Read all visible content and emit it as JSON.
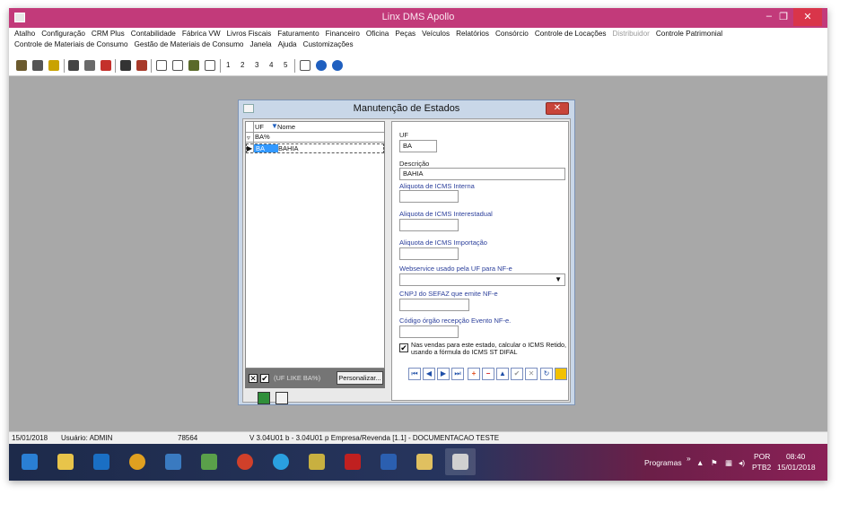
{
  "window": {
    "title": "Linx DMS Apollo",
    "minimize_glyph": "–",
    "restore_glyph": "❐",
    "close_glyph": "✕"
  },
  "menu": {
    "row1": [
      "Atalho",
      "Configuração",
      "CRM Plus",
      "Contabilidade",
      "Fábrica VW",
      "Livros Fiscais",
      "Faturamento",
      "Financeiro",
      "Oficina",
      "Peças",
      "Veículos",
      "Relatórios",
      "Consórcio",
      "Controle de Locações",
      "Distribuidor",
      "Controle Patrimonial"
    ],
    "row1_disabled": "Distribuidor",
    "row2": [
      "Controle de Materiais de Consumo",
      "Gestão de Materiais de Consumo",
      "Janela",
      "Ajuda",
      "Customizações"
    ]
  },
  "toolbar": {
    "numbers": [
      "1",
      "2",
      "3",
      "4",
      "5"
    ]
  },
  "dialog": {
    "title": "Manutenção de Estados",
    "close_glyph": "✕",
    "grid": {
      "col_uf": "UF",
      "col_nome": "Nome",
      "filter_value": "BA%",
      "rows": [
        {
          "uf": "BA",
          "nome": "BAHIA"
        }
      ]
    },
    "filter": {
      "expression": "(UF LIKE BA%)",
      "personalize_label": "Personalizar..."
    },
    "form": {
      "uf_label": "UF",
      "uf_value": "BA",
      "descricao_label": "Descrição",
      "descricao_value": "BAHIA",
      "icms_interna_label": "Aliquota de ICMS Interna",
      "icms_interestadual_label": "Aliquota de ICMS Interestadual",
      "icms_importacao_label": "Aliquota de ICMS Importação",
      "webservice_label": "Webservice usado pela UF para NF-e",
      "cnpj_label": "CNPJ do SEFAZ que emite NF-e",
      "codigo_orgao_label": "Código órgão recepção Evento NF-e.",
      "check_text_1": "Nas vendas para este estado, calcular o ICMS Retido,",
      "check_text_2": "usando a fórmula do ICMS ST DIFAL",
      "check_mark": "✔"
    }
  },
  "status": {
    "date": "15/01/2018",
    "user": "Usuário: ADMIN",
    "code": "78564",
    "version": "V 3.04U01 b  -  3.04U01 p   Empresa/Revenda [1.1] - DOCUMENTACAO TESTE"
  },
  "taskbar": {
    "programs": "Programas",
    "chevron": "»",
    "lang1": "POR",
    "lang2": "PTB2",
    "time": "08:40",
    "date": "15/01/2018"
  },
  "colors": {
    "titlebar": "#c23a7a",
    "desktop_gray": "#a8a8a8",
    "dialog_blue": "#c9d7e8",
    "selection_blue": "#3399ff",
    "label_blue": "#2b3f9b"
  }
}
